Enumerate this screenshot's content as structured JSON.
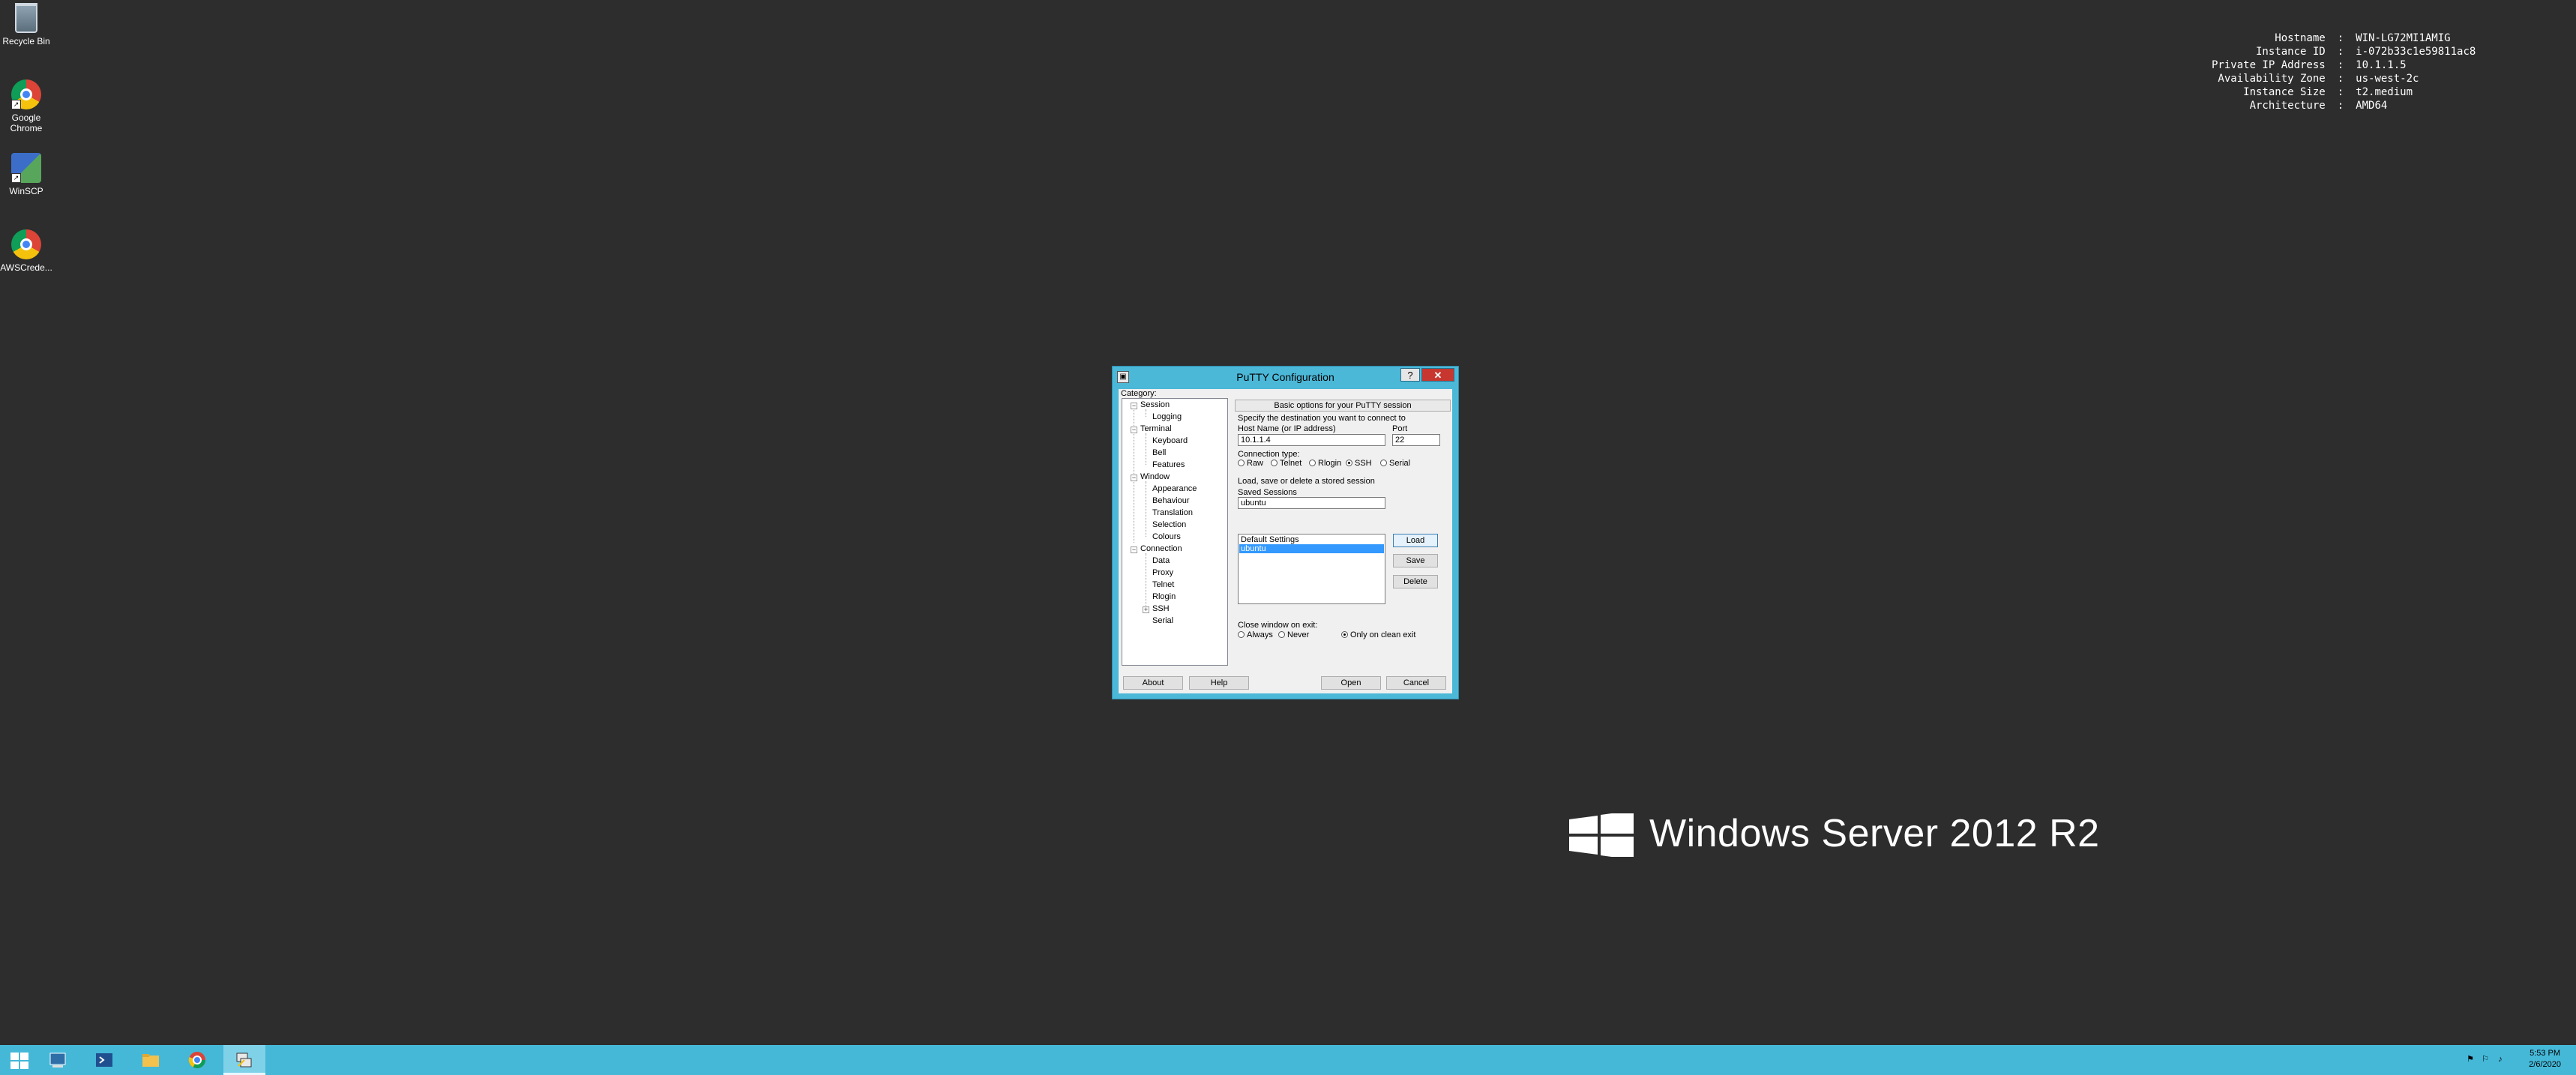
{
  "desktop": {
    "icons": [
      {
        "label": "Recycle Bin",
        "icon": "recycle-bin-icon"
      },
      {
        "label": "Google Chrome",
        "icon": "chrome-icon"
      },
      {
        "label": "WinSCP",
        "icon": "winscp-icon"
      },
      {
        "label": "AWSCrede...",
        "icon": "chrome-icon"
      }
    ],
    "info": [
      {
        "key": "Hostname",
        "value": "WIN-LG72MI1AMIG"
      },
      {
        "key": "Instance ID",
        "value": "i-072b33c1e59811ac8"
      },
      {
        "key": "Private IP Address",
        "value": "10.1.1.5"
      },
      {
        "key": "Availability Zone",
        "value": "us-west-2c"
      },
      {
        "key": "Instance Size",
        "value": "t2.medium"
      },
      {
        "key": "Architecture",
        "value": "AMD64"
      }
    ],
    "separator": ":",
    "brand": "Windows Server 2012 R2"
  },
  "putty": {
    "title": "PuTTY Configuration",
    "help_button": "?",
    "close_button": "✕",
    "category_label": "Category:",
    "tree": {
      "session": "Session",
      "logging": "Logging",
      "terminal": "Terminal",
      "keyboard": "Keyboard",
      "bell": "Bell",
      "features": "Features",
      "window": "Window",
      "appearance": "Appearance",
      "behaviour": "Behaviour",
      "translation": "Translation",
      "selection": "Selection",
      "colours": "Colours",
      "connection": "Connection",
      "data": "Data",
      "proxy": "Proxy",
      "telnet": "Telnet",
      "rlogin": "Rlogin",
      "ssh": "SSH",
      "serial": "Serial"
    },
    "header": "Basic options for your PuTTY session",
    "destination_label": "Specify the destination you want to connect to",
    "host_label": "Host Name (or IP address)",
    "host_value": "10.1.1.4",
    "port_label": "Port",
    "port_value": "22",
    "connection_type_label": "Connection type:",
    "conn_types": {
      "raw": "Raw",
      "telnet": "Telnet",
      "rlogin": "Rlogin",
      "ssh": "SSH",
      "serial": "Serial"
    },
    "conn_selected": "SSH",
    "sessions_group_label": "Load, save or delete a stored session",
    "saved_sessions_label": "Saved Sessions",
    "saved_session_value": "ubuntu",
    "sessions": {
      "default": "Default Settings",
      "ubuntu": "ubuntu"
    },
    "load": "Load",
    "save": "Save",
    "delete": "Delete",
    "close_label": "Close window on exit:",
    "close_opts": {
      "always": "Always",
      "never": "Never",
      "clean": "Only on clean exit"
    },
    "close_selected": "Only on clean exit",
    "about": "About",
    "help": "Help",
    "open": "Open",
    "cancel": "Cancel"
  },
  "taskbar": {
    "time": "5:53 PM",
    "date": "2/6/2020"
  }
}
